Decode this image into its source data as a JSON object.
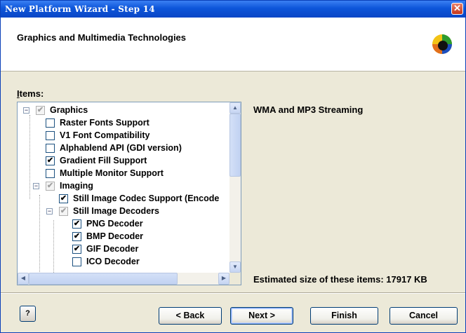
{
  "window": {
    "title": "New Platform Wizard - Step 14",
    "close_glyph": "✕"
  },
  "header": {
    "title": "Graphics and Multimedia Technologies",
    "logo_icon": "colorful-globe-icon"
  },
  "items_label_prefix": "I",
  "items_label_rest": "tems:",
  "tree": {
    "graphics": "Graphics",
    "raster": "Raster Fonts Support",
    "v1font": "V1 Font Compatibility",
    "alphablend": "Alphablend API (GDI version)",
    "gradient": "Gradient Fill Support",
    "multimon": "Multiple Monitor Support",
    "imaging": "Imaging",
    "codec": "Still Image Codec Support (Encode",
    "decoders": "Still Image Decoders",
    "png": "PNG Decoder",
    "bmp": "BMP Decoder",
    "gif": "GIF Decoder",
    "ico": "ICO Decoder"
  },
  "checks": {
    "checked": "✔",
    "expander": "−"
  },
  "description": "WMA and MP3 Streaming",
  "estimate": "Estimated size of these items: 17917 KB",
  "buttons": {
    "help": "?",
    "back": "< Back",
    "next": "Next >",
    "finish": "Finish",
    "cancel": "Cancel"
  },
  "scroll": {
    "up": "▲",
    "down": "▼",
    "left": "◀",
    "right": "▶"
  },
  "colors": {
    "titlebar": "#0d55d9",
    "accent": "#003c74"
  }
}
